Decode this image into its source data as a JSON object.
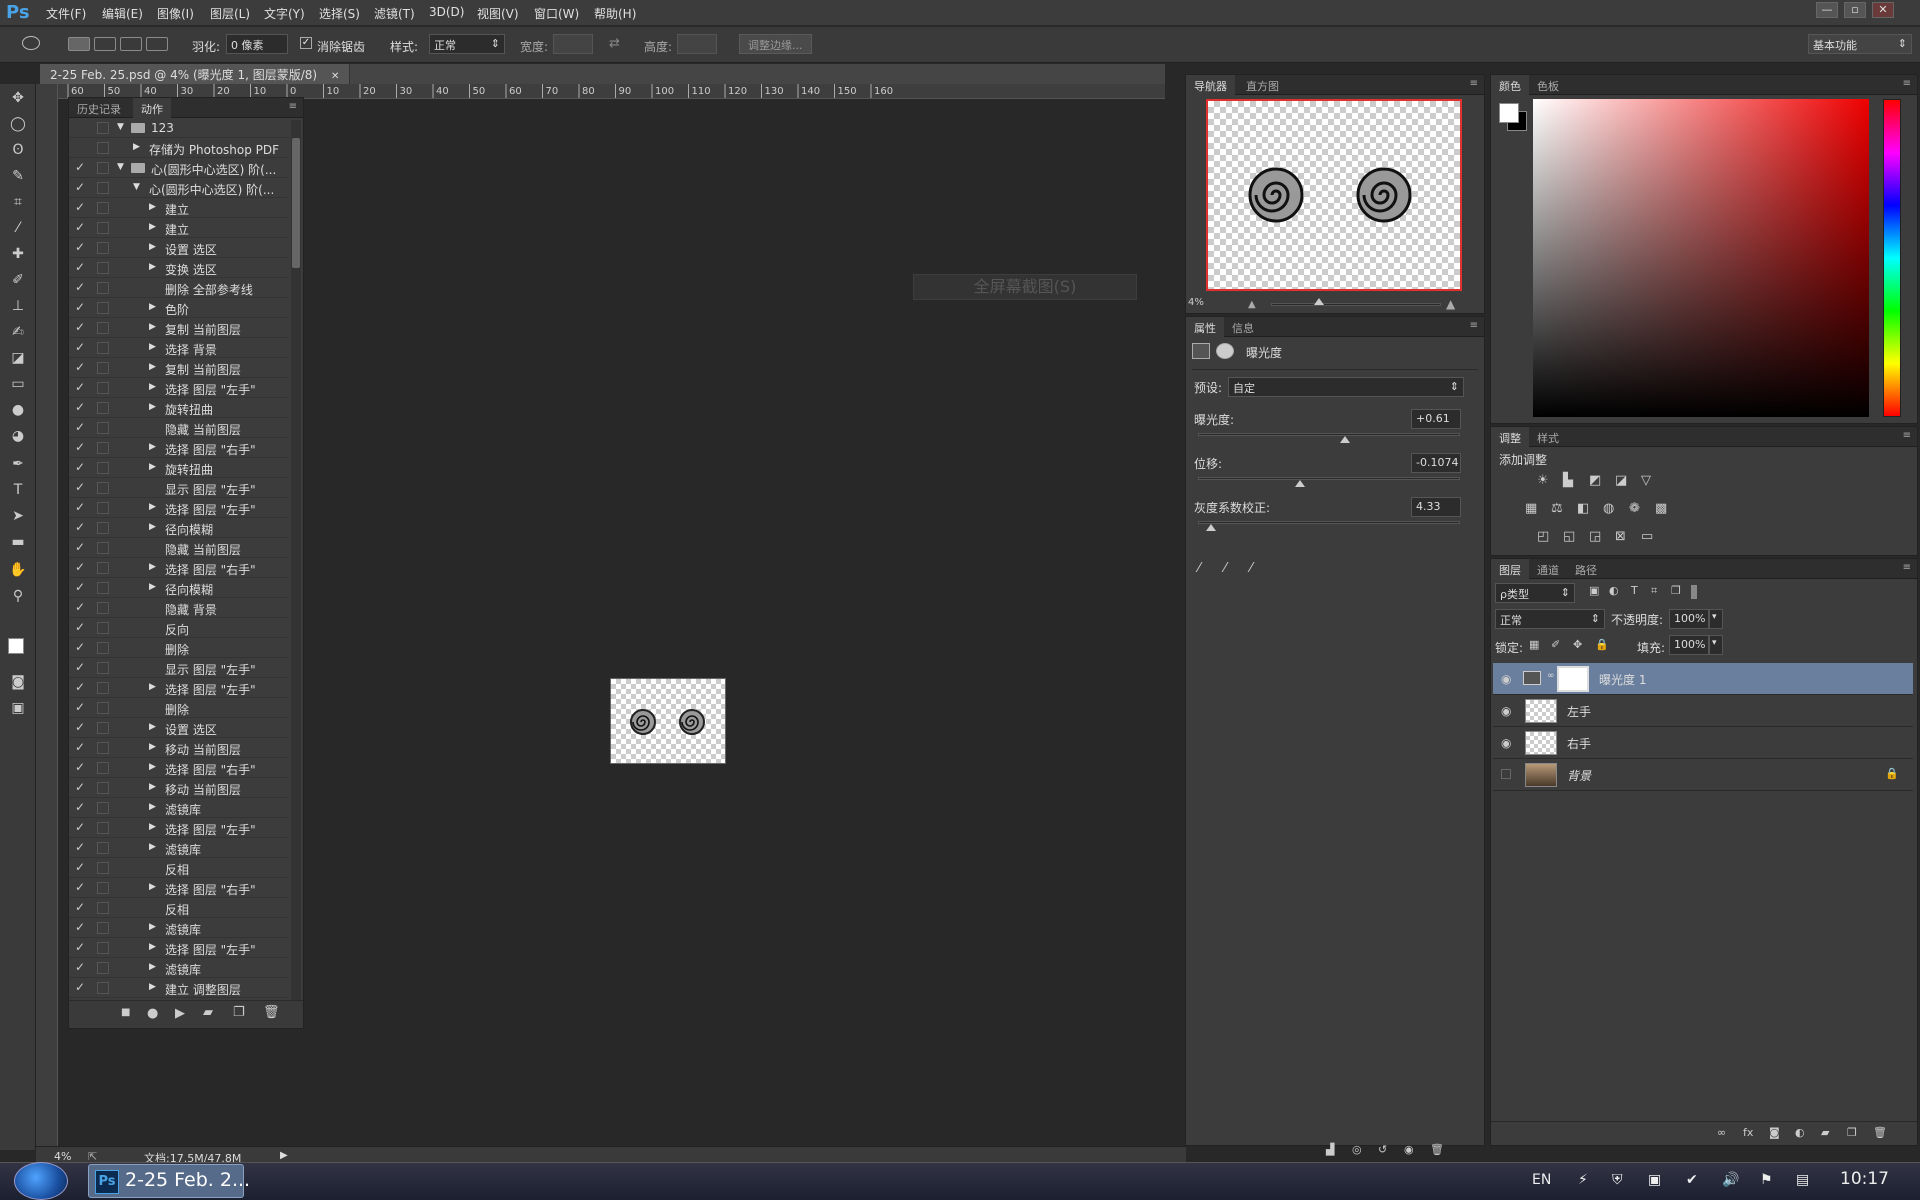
{
  "app": {
    "logo": "Ps",
    "title_bar_buttons": [
      "—",
      "▫",
      "✕"
    ]
  },
  "menu": [
    "文件(F)",
    "编辑(E)",
    "图像(I)",
    "图层(L)",
    "文字(Y)",
    "选择(S)",
    "滤镜(T)",
    "3D(D)",
    "视图(V)",
    "窗口(W)",
    "帮助(H)"
  ],
  "options": {
    "feather_label": "羽化:",
    "feather_value": "0 像素",
    "antialias_label": "消除锯齿",
    "style_label": "样式:",
    "style_value": "正常",
    "width_label": "宽度:",
    "height_label": "高度:",
    "refine_edge_button": "调整边缘...",
    "workspace": "基本功能"
  },
  "document": {
    "tab_title": "2-25 Feb. 25.psd @ 4% (曝光度 1, 图层蒙版/8)",
    "close_glyph": "✕",
    "fullscreen_tip": "全屏幕截图(S)"
  },
  "ruler": {
    "h_ticks": [
      "60",
      "50",
      "40",
      "30",
      "20",
      "10",
      "0",
      "10",
      "20",
      "30",
      "40",
      "50",
      "60",
      "70",
      "80",
      "90",
      "100",
      "110",
      "120",
      "130",
      "140",
      "150",
      "160"
    ]
  },
  "actions_panel": {
    "tabs": [
      "历史记录",
      "动作"
    ],
    "rows": [
      {
        "check": "",
        "tri": "▼",
        "folder": true,
        "label": "123",
        "indent": 0
      },
      {
        "check": "",
        "tri": "▶",
        "label": "存储为 Photoshop PDF",
        "indent": 1
      },
      {
        "check": "✓",
        "tri": "▼",
        "folder": true,
        "label": "心(圆形中心选区) 阶(...",
        "indent": 0
      },
      {
        "check": "✓",
        "tri": "▼",
        "label": "心(圆形中心选区) 阶(...",
        "indent": 1
      },
      {
        "check": "✓",
        "tri": "▶",
        "label": "建立",
        "indent": 2
      },
      {
        "check": "✓",
        "tri": "▶",
        "label": "建立",
        "indent": 2
      },
      {
        "check": "✓",
        "tri": "▶",
        "label": "设置 选区",
        "indent": 2
      },
      {
        "check": "✓",
        "tri": "▶",
        "label": "变换 选区",
        "indent": 2
      },
      {
        "check": "✓",
        "tri": "",
        "label": "删除 全部参考线",
        "indent": 2
      },
      {
        "check": "✓",
        "tri": "▶",
        "label": "色阶",
        "indent": 2
      },
      {
        "check": "✓",
        "tri": "▶",
        "label": "复制 当前图层",
        "indent": 2
      },
      {
        "check": "✓",
        "tri": "▶",
        "label": "选择 背景",
        "indent": 2
      },
      {
        "check": "✓",
        "tri": "▶",
        "label": "复制 当前图层",
        "indent": 2
      },
      {
        "check": "✓",
        "tri": "▶",
        "label": "选择 图层 \"左手\"",
        "indent": 2
      },
      {
        "check": "✓",
        "tri": "▶",
        "label": "旋转扭曲",
        "indent": 2
      },
      {
        "check": "✓",
        "tri": "",
        "label": "隐藏 当前图层",
        "indent": 2
      },
      {
        "check": "✓",
        "tri": "▶",
        "label": "选择 图层 \"右手\"",
        "indent": 2
      },
      {
        "check": "✓",
        "tri": "▶",
        "label": "旋转扭曲",
        "indent": 2
      },
      {
        "check": "✓",
        "tri": "",
        "label": "显示 图层 \"左手\"",
        "indent": 2
      },
      {
        "check": "✓",
        "tri": "▶",
        "label": "选择 图层 \"左手\"",
        "indent": 2
      },
      {
        "check": "✓",
        "tri": "▶",
        "label": "径向模糊",
        "indent": 2
      },
      {
        "check": "✓",
        "tri": "",
        "label": "隐藏 当前图层",
        "indent": 2
      },
      {
        "check": "✓",
        "tri": "▶",
        "label": "选择 图层 \"右手\"",
        "indent": 2
      },
      {
        "check": "✓",
        "tri": "▶",
        "label": "径向模糊",
        "indent": 2
      },
      {
        "check": "✓",
        "tri": "",
        "label": "隐藏 背景",
        "indent": 2
      },
      {
        "check": "✓",
        "tri": "",
        "label": "反向",
        "indent": 2
      },
      {
        "check": "✓",
        "tri": "",
        "label": "删除",
        "indent": 2
      },
      {
        "check": "✓",
        "tri": "",
        "label": "显示 图层 \"左手\"",
        "indent": 2
      },
      {
        "check": "✓",
        "tri": "▶",
        "label": "选择 图层 \"左手\"",
        "indent": 2
      },
      {
        "check": "✓",
        "tri": "",
        "label": "删除",
        "indent": 2
      },
      {
        "check": "✓",
        "tri": "▶",
        "label": "设置 选区",
        "indent": 2
      },
      {
        "check": "✓",
        "tri": "▶",
        "label": "移动 当前图层",
        "indent": 2
      },
      {
        "check": "✓",
        "tri": "▶",
        "label": "选择 图层 \"右手\"",
        "indent": 2
      },
      {
        "check": "✓",
        "tri": "▶",
        "label": "移动 当前图层",
        "indent": 2
      },
      {
        "check": "✓",
        "tri": "▶",
        "label": "滤镜库",
        "indent": 2
      },
      {
        "check": "✓",
        "tri": "▶",
        "label": "选择 图层 \"左手\"",
        "indent": 2
      },
      {
        "check": "✓",
        "tri": "▶",
        "label": "滤镜库",
        "indent": 2
      },
      {
        "check": "✓",
        "tri": "",
        "label": "反相",
        "indent": 2
      },
      {
        "check": "✓",
        "tri": "▶",
        "label": "选择 图层 \"右手\"",
        "indent": 2
      },
      {
        "check": "✓",
        "tri": "",
        "label": "反相",
        "indent": 2
      },
      {
        "check": "✓",
        "tri": "▶",
        "label": "滤镜库",
        "indent": 2
      },
      {
        "check": "✓",
        "tri": "▶",
        "label": "选择 图层 \"左手\"",
        "indent": 2
      },
      {
        "check": "✓",
        "tri": "▶",
        "label": "滤镜库",
        "indent": 2
      },
      {
        "check": "✓",
        "tri": "▶",
        "label": "建立 调整图层",
        "indent": 2
      }
    ]
  },
  "navigator": {
    "tabs": [
      "导航器",
      "直方图"
    ],
    "zoom": "4%"
  },
  "properties": {
    "tabs": [
      "属性",
      "信息"
    ],
    "title": "曝光度",
    "preset_label": "预设:",
    "preset_value": "自定",
    "exposure_label": "曝光度:",
    "exposure_value": "+0.61",
    "exposure_fraction": 0.56,
    "offset_label": "位移:",
    "offset_value": "-0.1074",
    "offset_fraction": 0.39,
    "gamma_label": "灰度系数校正:",
    "gamma_value": "4.33",
    "gamma_fraction": 0.05
  },
  "color": {
    "tabs": [
      "颜色",
      "色板"
    ]
  },
  "adjustments": {
    "tabs": [
      "调整",
      "样式"
    ],
    "title": "添加调整"
  },
  "layers": {
    "tabs": [
      "图层",
      "通道",
      "路径"
    ],
    "filter_label": "ρ类型",
    "blend_mode": "正常",
    "opacity_label": "不透明度:",
    "opacity_value": "100%",
    "lock_label": "锁定:",
    "fill_label": "填充:",
    "fill_value": "100%",
    "items": [
      {
        "name": "曝光度 1",
        "visible": true,
        "selected": true
      },
      {
        "name": "左手",
        "visible": true,
        "selected": false
      },
      {
        "name": "右手",
        "visible": true,
        "selected": false
      },
      {
        "name": "背景",
        "visible": false,
        "selected": false
      }
    ]
  },
  "status": {
    "zoom": "4%",
    "doc_info": "文档:17.5M/47.8M"
  },
  "taskbar": {
    "item_label": "2-25 Feb. 2...",
    "lang": "EN",
    "clock": "10:17"
  }
}
